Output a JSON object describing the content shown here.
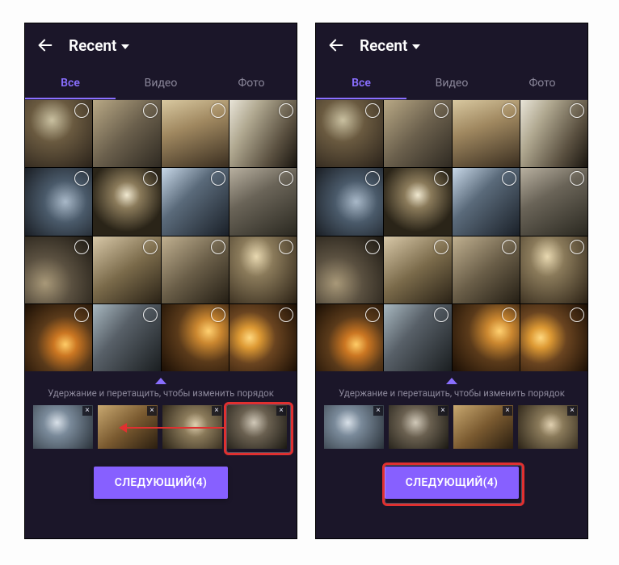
{
  "header": {
    "title": "Recent"
  },
  "tabs": {
    "all": "Все",
    "video": "Видео",
    "photo": "Фото"
  },
  "hint": "Удержание и перетащить, чтобы изменить порядок",
  "button": {
    "next": "СЛЕДУЮЩИЙ(4)"
  }
}
